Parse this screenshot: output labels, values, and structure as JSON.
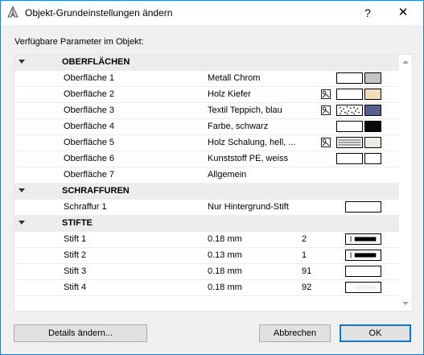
{
  "window": {
    "title": "Objekt-Grundeinstellungen ändern",
    "help_label": "?",
    "close_label": "✕"
  },
  "list_label": "Verfügbare Parameter im Objekt:",
  "groups": {
    "surfaces": {
      "label": "OBERFLÄCHEN",
      "rows": [
        {
          "name": "Oberfläche 1",
          "value": "Metall Chrom",
          "swatch_b": "#c4c4c4",
          "map_icon": false
        },
        {
          "name": "Oberfläche 2",
          "value": "Holz Kiefer",
          "swatch_b": "#f2deb8",
          "map_icon": true
        },
        {
          "name": "Oberfläche 3",
          "value": "Textil Teppich, blau",
          "swatch_b": "#55608f",
          "map_icon": true
        },
        {
          "name": "Oberfläche 4",
          "value": "Farbe, schwarz",
          "swatch_b": "#0a0a0a",
          "map_icon": false
        },
        {
          "name": "Oberfläche 5",
          "value": "Holz Schalung, hell, ...",
          "swatch_b": "#ecebe6",
          "map_icon": true
        },
        {
          "name": "Oberfläche 6",
          "value": "Kunststoff PE, weiss",
          "swatch_b": "#ffffff",
          "map_icon": false
        },
        {
          "name": "Oberfläche 7",
          "value": "Allgemein",
          "swatch_b": null,
          "map_icon": false
        }
      ]
    },
    "hatches": {
      "label": "SCHRAFFUREN",
      "rows": [
        {
          "name": "Schraffur 1",
          "value": "Nur Hintergrund-Stift"
        }
      ]
    },
    "pens": {
      "label": "STIFTE",
      "rows": [
        {
          "name": "Stift 1",
          "value": "0.18 mm",
          "pen": "2"
        },
        {
          "name": "Stift 2",
          "value": "0.13 mm",
          "pen": "1"
        },
        {
          "name": "Stift 3",
          "value": "0.18 mm",
          "pen": "91"
        },
        {
          "name": "Stift 4",
          "value": "0.18 mm",
          "pen": "92"
        }
      ]
    }
  },
  "buttons": {
    "details": "Details ändern...",
    "cancel": "Abbrechen",
    "ok": "OK"
  },
  "colors": {
    "accent": "#0078d7",
    "group_row_bg": "#ececec"
  }
}
